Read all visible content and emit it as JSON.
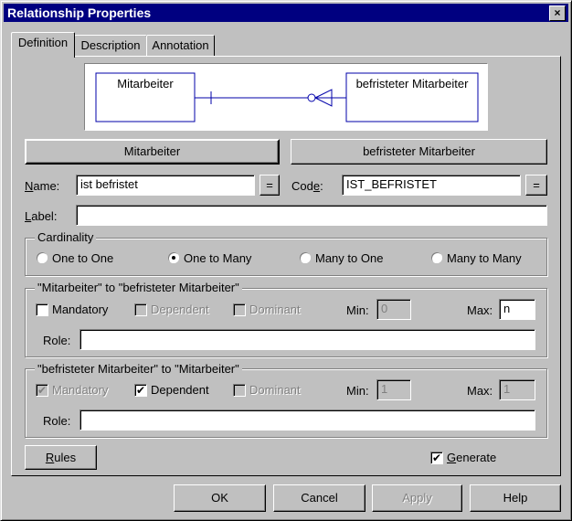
{
  "window": {
    "title": "Relationship Properties",
    "close_label": "×"
  },
  "tabs": [
    {
      "label": "Definition",
      "active": true
    },
    {
      "label": "Description",
      "active": false
    },
    {
      "label": "Annotation",
      "active": false
    }
  ],
  "diagram": {
    "entity_left": "Mitarbeiter",
    "entity_right": "befristeter Mitarbeiter"
  },
  "entity_buttons": {
    "left": "Mitarbeiter",
    "right": "befristeter Mitarbeiter"
  },
  "name": {
    "label": "Name:",
    "value": "ist befristet",
    "eq": "="
  },
  "code": {
    "label": "Code:",
    "value": "IST_BEFRISTET",
    "eq": "="
  },
  "label_field": {
    "label": "Label:",
    "value": ""
  },
  "cardinality": {
    "title": "Cardinality",
    "options": [
      {
        "label": "One to One",
        "selected": false
      },
      {
        "label": "One to Many",
        "selected": true
      },
      {
        "label": "Many to One",
        "selected": false
      },
      {
        "label": "Many to Many",
        "selected": false
      }
    ]
  },
  "role1": {
    "title": "\"Mitarbeiter\" to \"befristeter Mitarbeiter\"",
    "mandatory": {
      "label": "Mandatory",
      "checked": false,
      "enabled": true
    },
    "dependent": {
      "label": "Dependent",
      "checked": false,
      "enabled": false
    },
    "dominant": {
      "label": "Dominant",
      "checked": false,
      "enabled": false
    },
    "min_label": "Min:",
    "min_value": "0",
    "max_label": "Max:",
    "max_value": "n",
    "role_label": "Role:",
    "role_value": ""
  },
  "role2": {
    "title": "\"befristeter Mitarbeiter\" to \"Mitarbeiter\"",
    "mandatory": {
      "label": "Mandatory",
      "checked": true,
      "enabled": false
    },
    "dependent": {
      "label": "Dependent",
      "checked": true,
      "enabled": true
    },
    "dominant": {
      "label": "Dominant",
      "checked": false,
      "enabled": false
    },
    "min_label": "Min:",
    "min_value": "1",
    "max_label": "Max:",
    "max_value": "1",
    "role_label": "Role:",
    "role_value": ""
  },
  "rules_button": "Rules",
  "generate": {
    "label": "Generate",
    "checked": true
  },
  "footer": {
    "ok": "OK",
    "cancel": "Cancel",
    "apply": "Apply",
    "help": "Help"
  },
  "colors": {
    "titlebar": "#000080",
    "face": "#c0c0c0",
    "diagram_line": "#0000aa"
  }
}
